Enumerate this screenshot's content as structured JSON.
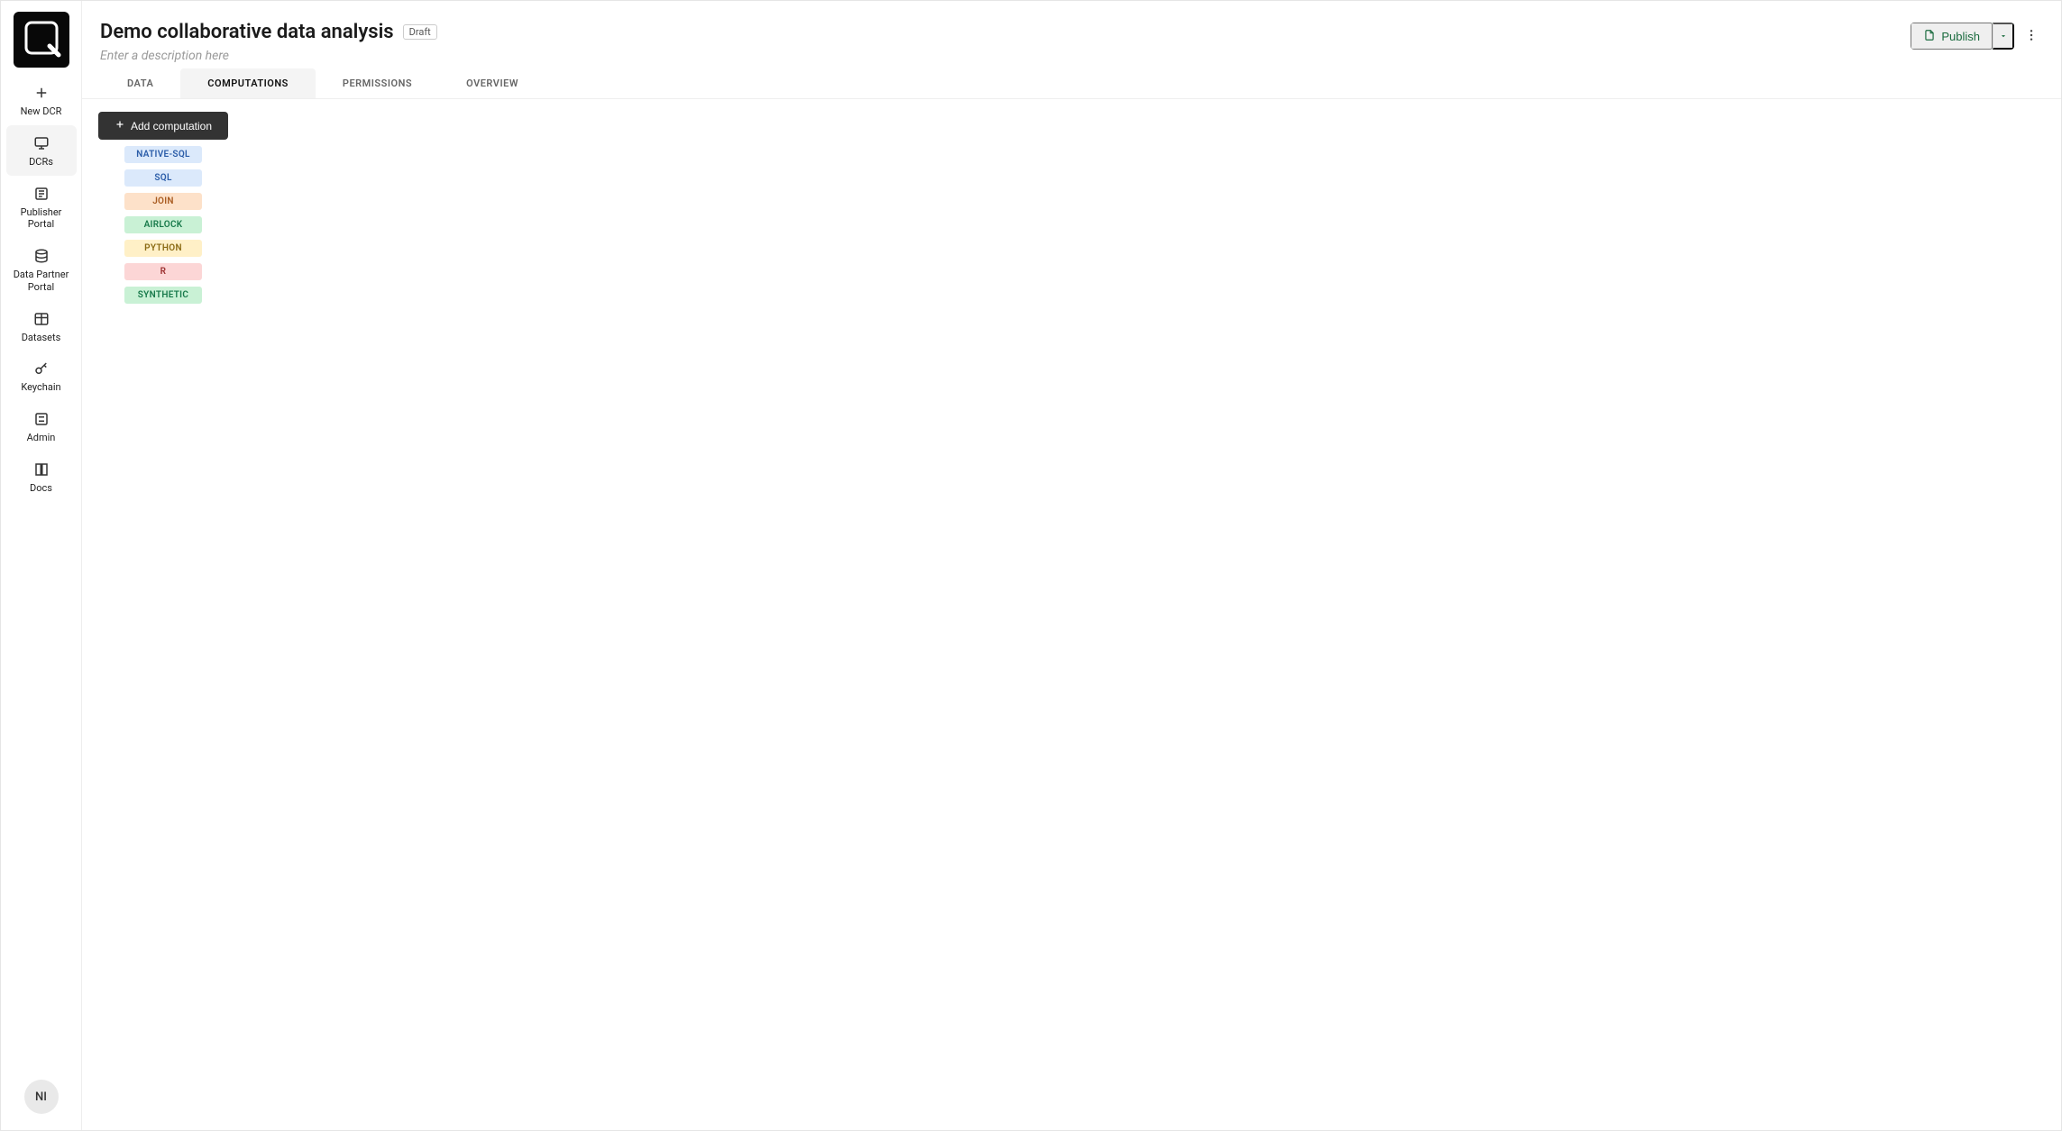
{
  "sidebar": {
    "avatar_initials": "NI",
    "items": [
      {
        "id": "new-dcr",
        "label": "New DCR",
        "active": false
      },
      {
        "id": "dcrs",
        "label": "DCRs",
        "active": true
      },
      {
        "id": "pub",
        "label": "Publisher Portal",
        "active": false
      },
      {
        "id": "dpp",
        "label": "Data Partner Portal",
        "active": false
      },
      {
        "id": "datasets",
        "label": "Datasets",
        "active": false
      },
      {
        "id": "keychain",
        "label": "Keychain",
        "active": false
      },
      {
        "id": "admin",
        "label": "Admin",
        "active": false
      },
      {
        "id": "docs",
        "label": "Docs",
        "active": false
      }
    ]
  },
  "header": {
    "title": "Demo collaborative data analysis",
    "status_badge": "Draft",
    "description_placeholder": "Enter a description here",
    "publish_label": "Publish"
  },
  "tabs": [
    {
      "id": "data",
      "label": "DATA",
      "active": false
    },
    {
      "id": "computations",
      "label": "COMPUTATIONS",
      "active": true
    },
    {
      "id": "permissions",
      "label": "PERMISSIONS",
      "active": false
    },
    {
      "id": "overview",
      "label": "OVERVIEW",
      "active": false
    }
  ],
  "computations_panel": {
    "add_label": "Add computation",
    "types": [
      {
        "id": "native-sql",
        "label": "NATIVE-SQL",
        "color": "blue"
      },
      {
        "id": "sql",
        "label": "SQL",
        "color": "blue"
      },
      {
        "id": "join",
        "label": "JOIN",
        "color": "orange"
      },
      {
        "id": "airlock",
        "label": "AIRLOCK",
        "color": "green"
      },
      {
        "id": "python",
        "label": "PYTHON",
        "color": "yellow"
      },
      {
        "id": "r",
        "label": "R",
        "color": "pink"
      },
      {
        "id": "synthetic",
        "label": "SYNTHETIC",
        "color": "green"
      }
    ]
  }
}
